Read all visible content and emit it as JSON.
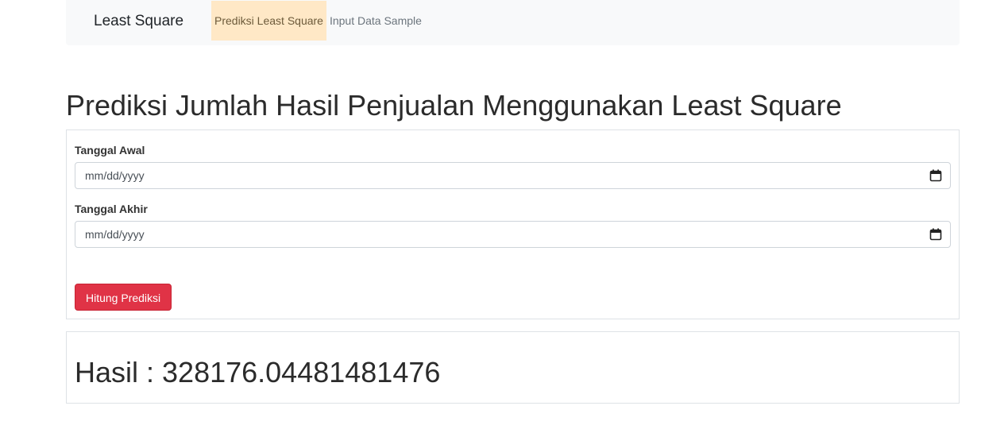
{
  "navbar": {
    "brand": "Least Square",
    "items": [
      {
        "label": "Prediksi Least Square",
        "active": true
      },
      {
        "label": "Input Data Sample",
        "active": false
      }
    ]
  },
  "page": {
    "title": "Prediksi Jumlah Hasil Penjualan Menggunakan Least Square"
  },
  "form": {
    "start_date": {
      "label": "Tanggal Awal",
      "placeholder": "mm/dd/yyyy",
      "icon": "calendar-icon"
    },
    "end_date": {
      "label": "Tanggal Akhir",
      "placeholder": "mm/dd/yyyy",
      "icon": "calendar-icon"
    },
    "submit_label": "Hitung Prediksi"
  },
  "result": {
    "text": "Hasil : 328176.04481481476"
  },
  "colors": {
    "navbar_bg": "#f8f9fa",
    "active_nav_bg": "#ffe8c6",
    "button_bg": "#e03346"
  }
}
